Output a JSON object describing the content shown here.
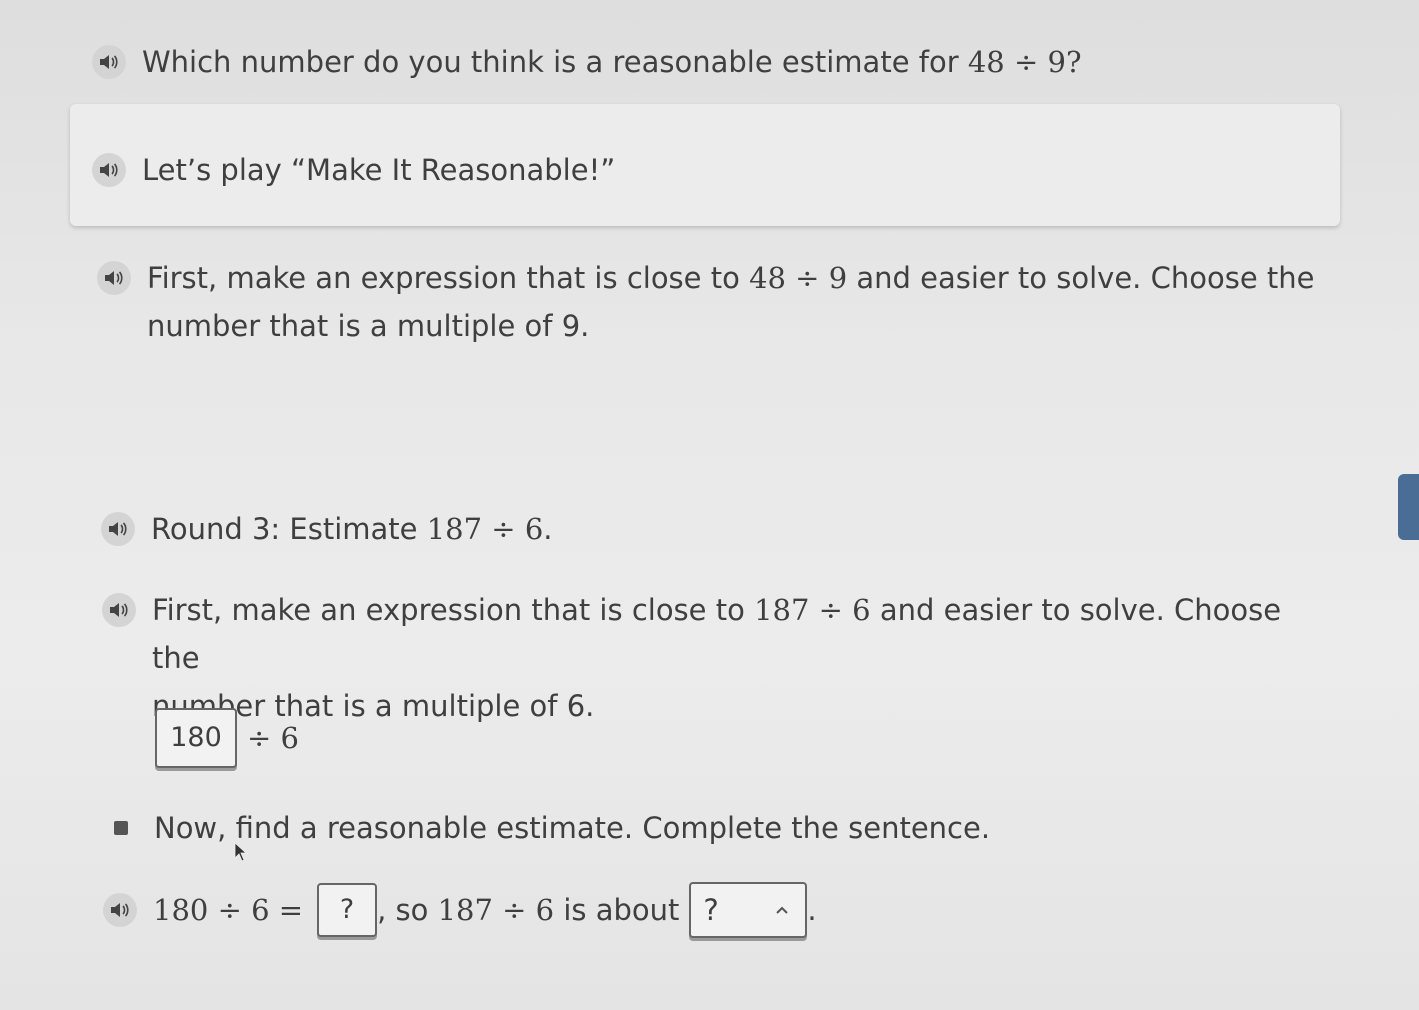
{
  "question": {
    "text": "Which number do you think is a reasonable estimate for ",
    "expr": "48 ÷ 9",
    "end": "?"
  },
  "banner": {
    "text": "Let’s play “Make It Reasonable!”"
  },
  "step1": {
    "text_a": "First, make an expression that is close to ",
    "expr": "48 ÷ 9",
    "text_b": " and easier to solve. Choose the",
    "line2": "number that is a multiple of 9."
  },
  "round": {
    "text": "Round 3: Estimate ",
    "expr": "187 ÷ 6",
    "end": "."
  },
  "step2": {
    "text_a": "First, make an expression that is close to ",
    "expr": "187 ÷ 6",
    "text_b": " and easier to solve. Choose the",
    "line2": "number that is a multiple of 6."
  },
  "chosen": {
    "value": "180",
    "divisor": "÷ 6"
  },
  "instruction": {
    "text": "Now, find a reasonable estimate. Complete the sentence."
  },
  "sentence": {
    "expr": "180 ÷ 6 =",
    "answer_placeholder": "?",
    "mid": ", so ",
    "expr2": "187 ÷ 6",
    "about": " is about",
    "dropdown_value": "?",
    "end": "."
  },
  "icons": {
    "speaker": "speaker-icon",
    "stop": "stop-icon",
    "chevron": "chevron-up-icon",
    "cursor": "mouse-cursor-icon"
  }
}
